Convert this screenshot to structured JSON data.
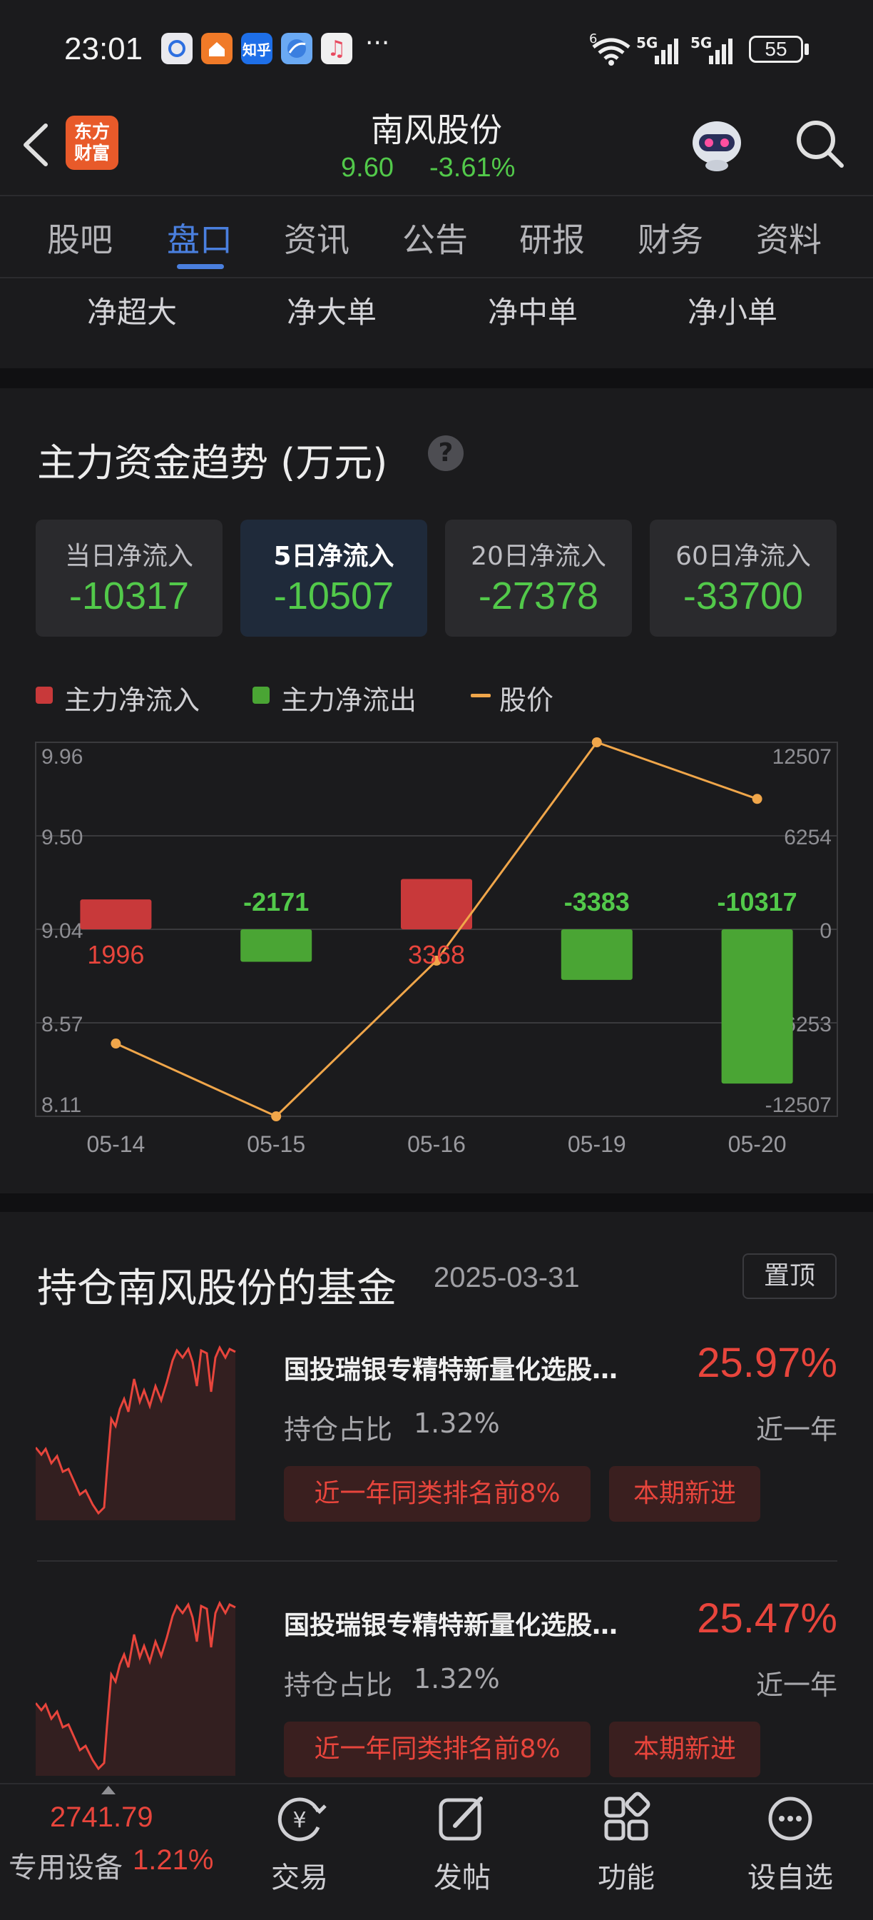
{
  "status_bar": {
    "time": "23:01",
    "apps": [
      {
        "icon": "baidu-icon",
        "color": "#e9e9ee",
        "text": ""
      },
      {
        "icon": "home-app-icon",
        "color": "#f07a28",
        "text": ""
      },
      {
        "icon": "zhihu-icon",
        "color": "#1e6fe8",
        "text": "知乎"
      },
      {
        "icon": "browser-icon",
        "color": "#6aa9f3",
        "text": ""
      },
      {
        "icon": "music-icon",
        "color": "#f0f0f0",
        "text": "♫"
      }
    ],
    "more": "···",
    "wifi_label": "6",
    "signal1_label": "5G",
    "signal2_label": "5G",
    "battery": "55"
  },
  "header": {
    "logo_line1": "东方",
    "logo_line2": "财富",
    "stock_name": "南风股份",
    "price": "9.60",
    "change_pct": "-3.61%"
  },
  "tabs": {
    "items": [
      "股吧",
      "盘口",
      "资讯",
      "公告",
      "研报",
      "财务",
      "资料"
    ],
    "active_index": 1
  },
  "subtabs": [
    "净超大",
    "净大单",
    "净中单",
    "净小单"
  ],
  "fund_flow": {
    "title": "主力资金趋势 (万元)",
    "help": "?",
    "cards": [
      {
        "label": "当日净流入",
        "value": "-10317"
      },
      {
        "label": "5日净流入",
        "value": "-10507"
      },
      {
        "label": "20日净流入",
        "value": "-27378"
      },
      {
        "label": "60日净流入",
        "value": "-33700"
      }
    ],
    "selected_card": 1,
    "legend": {
      "inflow": "主力净流入",
      "outflow": "主力净流出",
      "price": "股价"
    },
    "colors": {
      "inflow": "#c8393a",
      "outflow": "#4aa534",
      "price": "#f0a64a"
    }
  },
  "chart_data": {
    "type": "bar",
    "categories": [
      "05-14",
      "05-15",
      "05-16",
      "05-19",
      "05-20"
    ],
    "series": [
      {
        "name": "主力净流入/净流出",
        "values": [
          1996,
          -2171,
          3368,
          -3383,
          -10317
        ]
      },
      {
        "name": "股价",
        "values": [
          8.47,
          8.11,
          8.88,
          9.96,
          9.68
        ]
      }
    ],
    "data_labels": [
      "1996",
      "-2171",
      "3368",
      "-3383",
      "-10317"
    ],
    "left_axis": {
      "ticks": [
        "9.96",
        "9.50",
        "9.04",
        "8.57",
        "8.11"
      ],
      "range": [
        8.11,
        9.96
      ]
    },
    "right_axis": {
      "ticks": [
        "12507",
        "6254",
        "0",
        "-6253",
        "-12507"
      ],
      "range": [
        -12507,
        12507
      ]
    },
    "grid": true
  },
  "funds": {
    "title": "持仓南风股份的基金",
    "date": "2025-03-31",
    "pin_label": "置顶",
    "items": [
      {
        "name": "国投瑞银专精特新量化选股…",
        "return": "25.97%",
        "holding_label": "持仓占比",
        "holding_value": "1.32%",
        "period": "近一年",
        "badges": [
          "近一年同类排名前8%",
          "本期新进"
        ]
      },
      {
        "name": "国投瑞银专精特新量化选股…",
        "return": "25.47%",
        "holding_label": "持仓占比",
        "holding_value": "1.32%",
        "period": "近一年",
        "badges": [
          "近一年同类排名前8%",
          "本期新进"
        ]
      }
    ]
  },
  "bottom_nav": {
    "index_value": "2741.79",
    "index_name": "专用设备",
    "index_change": "1.21%",
    "items": [
      {
        "label": "交易",
        "icon": "trade-icon"
      },
      {
        "label": "发帖",
        "icon": "post-icon"
      },
      {
        "label": "功能",
        "icon": "functions-icon"
      },
      {
        "label": "设自选",
        "icon": "add-watchlist-icon"
      }
    ]
  }
}
